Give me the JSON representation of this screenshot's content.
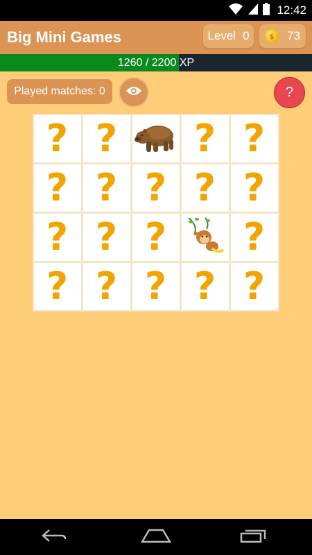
{
  "status_bar": {
    "time": "12:42",
    "icons": [
      "wifi-icon",
      "signal-icon",
      "battery-icon"
    ]
  },
  "app_bar": {
    "title": "Big Mini Games",
    "level_label": "Level",
    "level_value": "0",
    "coins": "73"
  },
  "xp": {
    "text": "1260 / 2200 XP",
    "current": 1260,
    "max": 2200
  },
  "controls": {
    "played_matches": "Played matches: 0",
    "help_label": "?"
  },
  "board": {
    "rows": 4,
    "cols": 5,
    "hidden_symbol": "?",
    "revealed": [
      {
        "row": 0,
        "col": 2,
        "card": "bear"
      },
      {
        "row": 2,
        "col": 3,
        "card": "monkey"
      }
    ]
  },
  "nav_bar": {
    "buttons": [
      "back-icon",
      "home-icon",
      "recent-apps-icon"
    ]
  },
  "colors": {
    "background": "#ffcc77",
    "app_bar": "#db9453",
    "xp_fill": "#0a8a1e",
    "question_mark": "#f2a400",
    "help_button": "#e8474f"
  }
}
